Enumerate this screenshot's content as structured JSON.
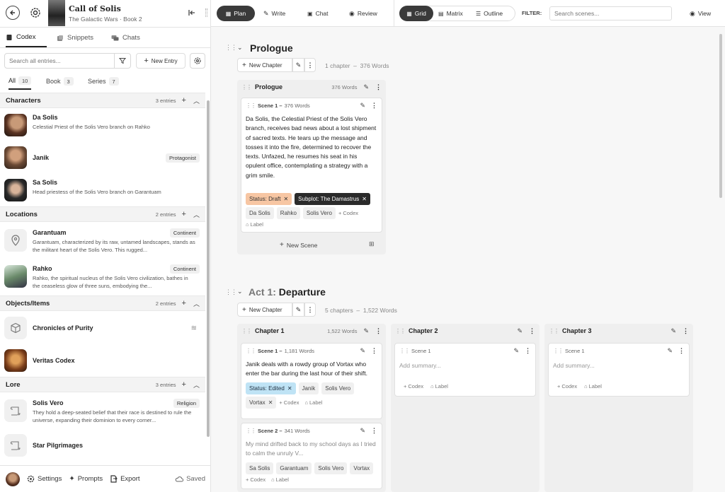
{
  "header": {
    "title": "Call of Solis",
    "subtitle": "The Galactic Wars · Book 2"
  },
  "sidebar_tabs": [
    {
      "label": "Codex"
    },
    {
      "label": "Snippets"
    },
    {
      "label": "Chats"
    }
  ],
  "search": {
    "placeholder": "Search all entries..."
  },
  "new_entry_label": "New Entry",
  "filters": [
    {
      "label": "All",
      "count": "10"
    },
    {
      "label": "Book",
      "count": "3"
    },
    {
      "label": "Series",
      "count": "7"
    }
  ],
  "sections": {
    "characters": {
      "title": "Characters",
      "count": "3 entries"
    },
    "locations": {
      "title": "Locations",
      "count": "2 entries"
    },
    "objects": {
      "title": "Objects/Items",
      "count": "2 entries"
    },
    "lore": {
      "title": "Lore",
      "count": "3 entries"
    }
  },
  "entries": {
    "da_solis": {
      "name": "Da Solis",
      "desc": "Celestial Priest of the Solis Vero branch on Rahko"
    },
    "janik": {
      "name": "Janik",
      "badge": "Protagonist"
    },
    "sa_solis": {
      "name": "Sa Solis",
      "desc": "Head priestess of the Solis Vero branch on Garantuam"
    },
    "garantuam": {
      "name": "Garantuam",
      "badge": "Continent",
      "desc": "Garantuam, characterized by its raw, untamed landscapes, stands as the militant heart of the Solis Vero. This rugged..."
    },
    "rahko": {
      "name": "Rahko",
      "badge": "Continent",
      "desc": "Rahko, the spiritual nucleus of the Solis Vero civilization, bathes in the ceaseless glow of three suns, embodying the..."
    },
    "chronicles": {
      "name": "Chronicles of Purity"
    },
    "veritas": {
      "name": "Veritas Codex"
    },
    "solis_vero": {
      "name": "Solis Vero",
      "badge": "Religion",
      "desc": "They hold a deep-seated belief that their race is destined to rule the universe, expanding their dominion to every corner..."
    },
    "pilgrimages": {
      "name": "Star Pilgrimages"
    }
  },
  "footer": {
    "settings": "Settings",
    "prompts": "Prompts",
    "export": "Export",
    "saved": "Saved"
  },
  "topbar": {
    "modes": [
      "Plan",
      "Write",
      "Chat",
      "Review"
    ],
    "views": [
      "Grid",
      "Matrix",
      "Outline"
    ],
    "filter_label": "FILTER:",
    "search_placeholder": "Search scenes...",
    "view": "View"
  },
  "prologue": {
    "act_title": "Prologue",
    "new_chapter": "New Chapter",
    "meta": "1 chapter  –  376 Words",
    "chapter_title": "Prologue",
    "chapter_words": "376 Words",
    "scene_label": "Scene 1 –",
    "scene_words": "376 Words",
    "summary": "Da Solis, the Celestial Priest of the Solis Vero branch, receives bad news about a lost shipment of sacred texts. He tears up the message and tosses it into the fire, determined to recover the texts. Unfazed, he resumes his seat in his opulent office, contemplating a strategy with a grim smile.",
    "status": "Status: Draft",
    "subplot": "Subplot: The Damastrus",
    "codex_chips": [
      "Da Solis",
      "Rahko",
      "Solis Vero"
    ],
    "add_codex": "Codex",
    "add_label": "Label",
    "new_scene": "New Scene"
  },
  "act1": {
    "prefix": "Act 1:",
    "title": "Departure",
    "new_chapter": "New Chapter",
    "meta": "5 chapters  –  1,522 Words",
    "ch1": {
      "title": "Chapter 1",
      "words": "1,522 Words",
      "s1": {
        "label": "Scene 1 –",
        "words": "1,181 Words",
        "summary": "Janik deals with a rowdy group of Vortax who enter the bar during the last hour of their shift.",
        "status": "Status: Edited",
        "chips": [
          "Janik",
          "Solis Vero"
        ],
        "chip_x": "Vortax"
      },
      "s2": {
        "label": "Scene 2 –",
        "words": "341 Words",
        "summary": "My mind drifted back to my school days as I tried to calm the unruly V...",
        "chips": [
          "Sa Solis",
          "Garantuam",
          "Solis Vero",
          "Vortax"
        ]
      }
    },
    "ch2": {
      "title": "Chapter 2",
      "scene": "Scene 1",
      "placeholder": "Add summary..."
    },
    "ch3": {
      "title": "Chapter 3",
      "scene": "Scene 1",
      "placeholder": "Add summary..."
    }
  },
  "colors": {
    "accent_dark": "#3a3a3a",
    "status_draft": "#f7c6a3",
    "status_edited": "#bfe3f5",
    "subplot": "#2b2b2b"
  }
}
